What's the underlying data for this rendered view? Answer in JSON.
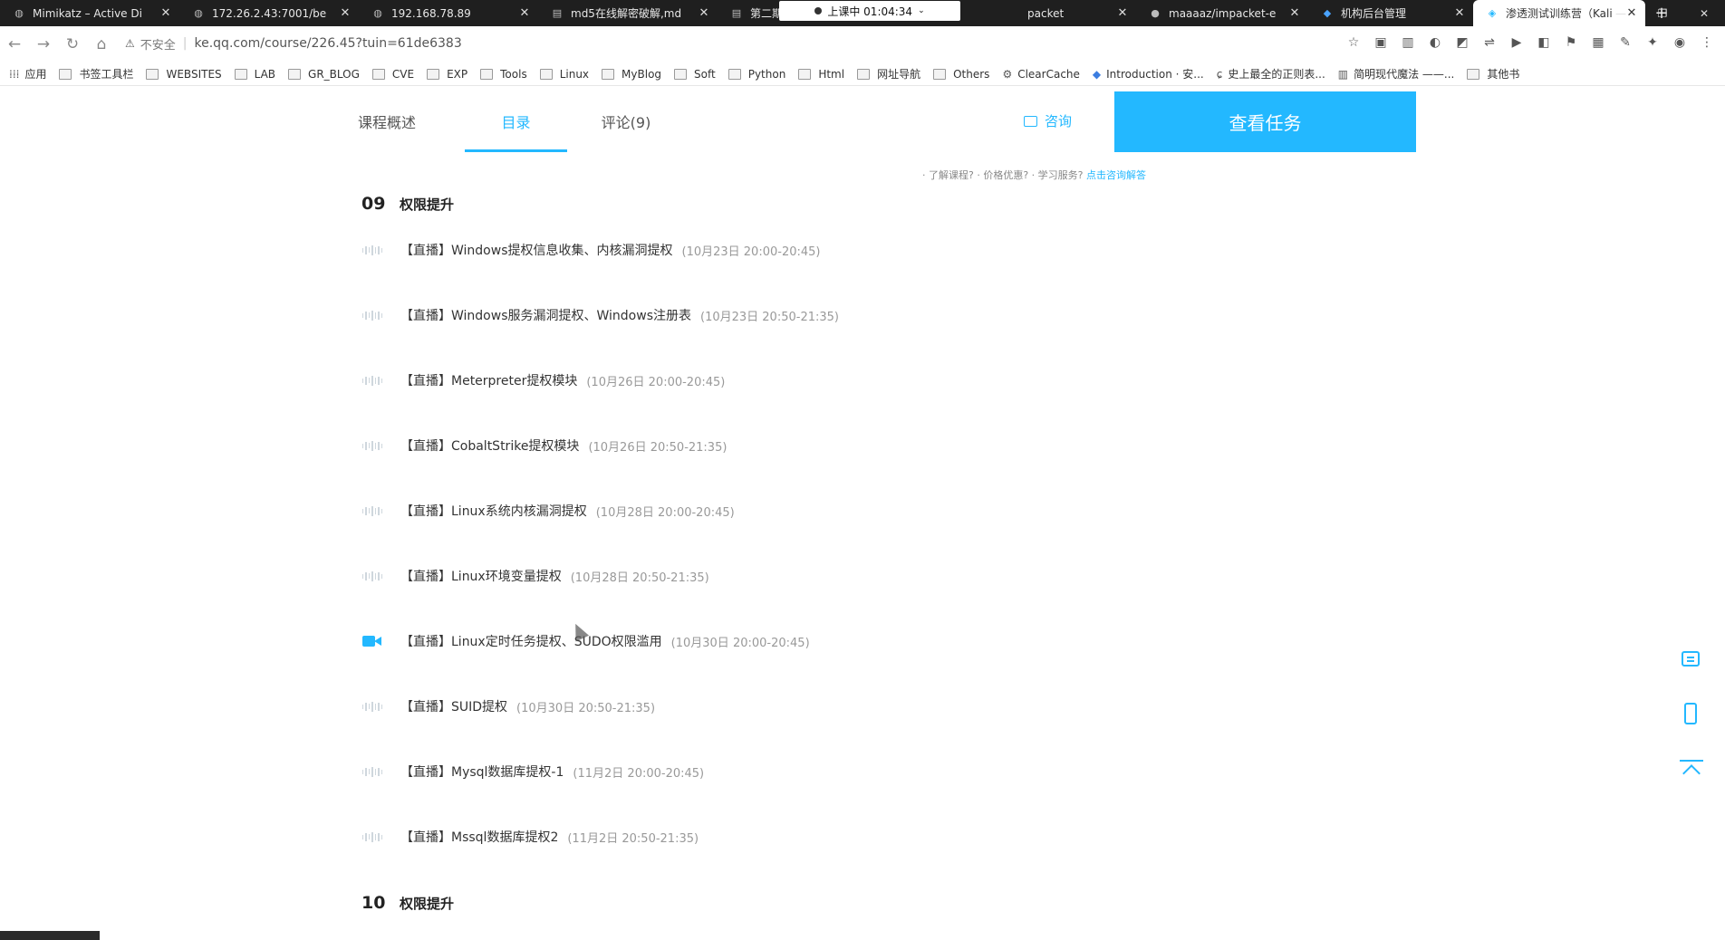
{
  "browser": {
    "tabs": [
      {
        "title": "Mimikatz – Active Di",
        "icon": "globe-icon"
      },
      {
        "title": "172.26.2.43:7001/be",
        "icon": "globe-icon"
      },
      {
        "title": "192.168.78.89",
        "icon": "globe-icon"
      },
      {
        "title": "md5在线解密破解,md",
        "icon": "doc-icon"
      },
      {
        "title": "第二期预习",
        "icon": "doc-icon"
      },
      {
        "title": "packet",
        "icon": "doc-icon"
      },
      {
        "title": "maaaaz/impacket-e",
        "icon": "github-icon"
      },
      {
        "title": "机构后台管理",
        "icon": "diamond-icon"
      },
      {
        "title": "渗透测试训练营（Kali",
        "icon": "course-icon",
        "active": true
      }
    ],
    "live_badge": "上课中 01:04:34",
    "address": {
      "security_label": "不安全",
      "url": "ke.qq.com/course/226.45?tuin=61de6383"
    },
    "bookmarks": [
      {
        "label": "应用",
        "icon": "apps-icon"
      },
      {
        "label": "书签工具栏",
        "icon": "folder-icon"
      },
      {
        "label": "WEBSITES",
        "icon": "folder-icon"
      },
      {
        "label": "LAB",
        "icon": "folder-icon"
      },
      {
        "label": "GR_BLOG",
        "icon": "folder-icon"
      },
      {
        "label": "CVE",
        "icon": "folder-icon"
      },
      {
        "label": "EXP",
        "icon": "folder-icon"
      },
      {
        "label": "Tools",
        "icon": "folder-icon"
      },
      {
        "label": "Linux",
        "icon": "folder-icon"
      },
      {
        "label": "MyBlog",
        "icon": "folder-icon"
      },
      {
        "label": "Soft",
        "icon": "folder-icon"
      },
      {
        "label": "Python",
        "icon": "folder-icon"
      },
      {
        "label": "Html",
        "icon": "folder-icon"
      },
      {
        "label": "网址导航",
        "icon": "folder-icon"
      },
      {
        "label": "Others",
        "icon": "folder-icon"
      },
      {
        "label": "ClearCache",
        "icon": "gear-icon"
      },
      {
        "label": "Introduction · 安...",
        "icon": "layers-icon"
      },
      {
        "label": "史上最全的正则表...",
        "icon": "regex-icon"
      },
      {
        "label": "简明现代魔法 ——...",
        "icon": "book-icon"
      },
      {
        "label": "其他书",
        "icon": "folder-icon"
      }
    ]
  },
  "page": {
    "tabs": [
      "课程概述",
      "目录",
      "评论(9)"
    ],
    "active_tab": "目录",
    "consult_label": "咨询",
    "task_button": "查看任务",
    "faq": {
      "text": "· 了解课程? · 价格优惠? · 学习服务?",
      "link": "点击咨询解答"
    },
    "chapters": [
      {
        "num": "09",
        "title": "权限提升"
      },
      {
        "num": "10",
        "title": "权限提升"
      }
    ],
    "lessons": [
      {
        "title": "【直播】Windows提权信息收集、内核漏洞提权",
        "time": "(10月23日 20:00-20:45)",
        "icon": "wave"
      },
      {
        "title": "【直播】Windows服务漏洞提权、Windows注册表",
        "time": "(10月23日 20:50-21:35)",
        "icon": "wave"
      },
      {
        "title": "【直播】Meterpreter提权模块",
        "time": "(10月26日 20:00-20:45)",
        "icon": "wave"
      },
      {
        "title": "【直播】CobaltStrike提权模块",
        "time": "(10月26日 20:50-21:35)",
        "icon": "wave"
      },
      {
        "title": "【直播】Linux系统内核漏洞提权",
        "time": "(10月28日 20:00-20:45)",
        "icon": "wave"
      },
      {
        "title": "【直播】Linux环境变量提权",
        "time": "(10月28日 20:50-21:35)",
        "icon": "wave"
      },
      {
        "title": "【直播】Linux定时任务提权、SUDO权限滥用",
        "time": "(10月30日 20:00-20:45)",
        "icon": "camera"
      },
      {
        "title": "【直播】SUID提权",
        "time": "(10月30日 20:50-21:35)",
        "icon": "wave"
      },
      {
        "title": "【直播】Mysql数据库提权-1",
        "time": "(11月2日 20:00-20:45)",
        "icon": "wave"
      },
      {
        "title": "【直播】Mssql数据库提权2",
        "time": "(11月2日 20:50-21:35)",
        "icon": "wave"
      }
    ]
  },
  "colors": {
    "accent": "#23b8ff",
    "tabstrip": "#1f1f1f"
  }
}
